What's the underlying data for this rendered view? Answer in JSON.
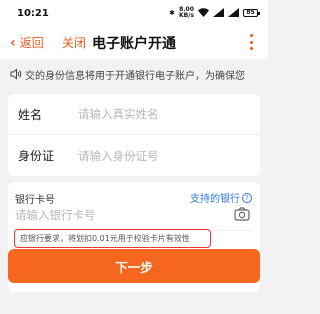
{
  "status_bar": {
    "time": "10:21",
    "speed_top": "8.00",
    "speed_bottom": "KB/s",
    "battery": "85"
  },
  "nav": {
    "back_label": "返回",
    "close_label": "关闭",
    "title": "电子账户开通"
  },
  "notice": {
    "text": "交的身份信息将用于开通银行电子账户，为确保您"
  },
  "identity_form": {
    "name_label": "姓名",
    "name_placeholder": "请输入真实姓名",
    "id_label": "身份证",
    "id_placeholder": "请输入身份证号"
  },
  "bank_card": {
    "label": "银行卡号",
    "support_link": "支持的银行",
    "placeholder": "请输入银行卡号",
    "tip": "应银行要求，将划扣0.01元用于校验卡片有效性"
  },
  "actions": {
    "next_label": "下一步"
  },
  "colors": {
    "accent": "#f5661f",
    "link": "#2f7be0",
    "highlight": "#e23a3a"
  }
}
